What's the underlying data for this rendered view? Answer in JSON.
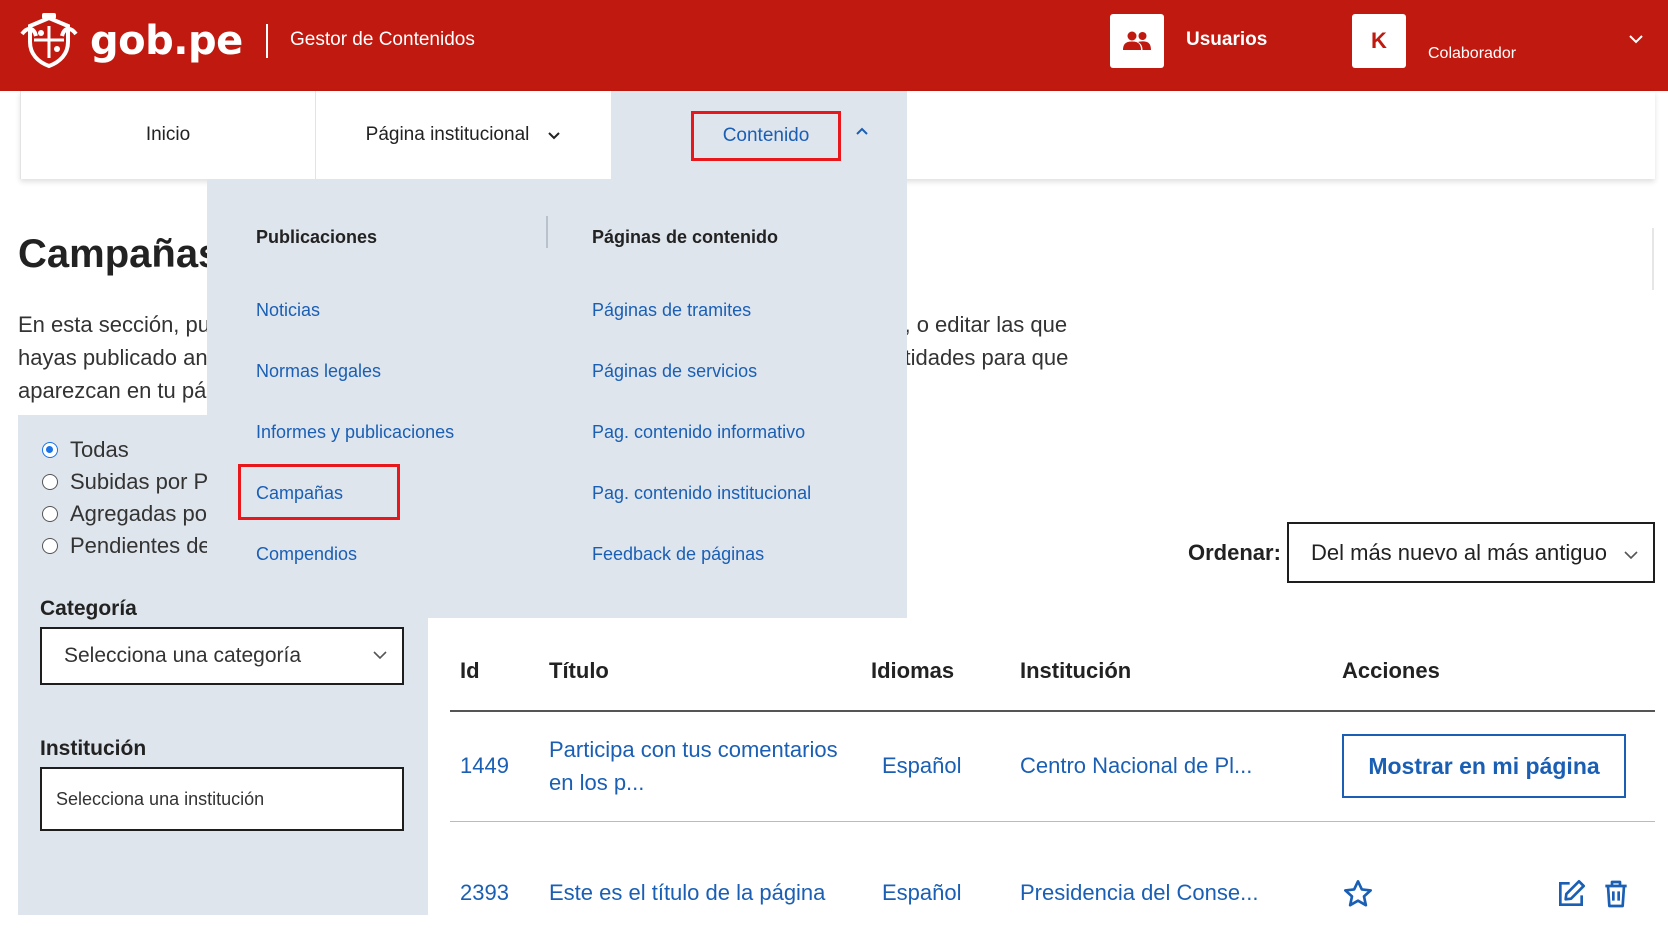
{
  "header": {
    "logo_text": "gob.pe",
    "app_name": "Gestor de Contenidos",
    "users_label": "Usuarios",
    "avatar_letter": "K",
    "role": "Colaborador",
    "brand_color": "#c0190f",
    "users_icon": "users-icon",
    "chevron_icon": "chevron-down-icon"
  },
  "nav": {
    "inicio": "Inicio",
    "pagina_institucional": "Página institucional",
    "contenido": "Contenido"
  },
  "mega_menu": {
    "col1_title": "Publicaciones",
    "col1_items": [
      "Noticias",
      "Normas legales",
      "Informes y publicaciones",
      "Campañas",
      "Compendios"
    ],
    "col2_title": "Páginas de contenido",
    "col2_items": [
      "Páginas de tramites",
      "Páginas de servicios",
      "Pag. contenido informativo",
      "Pag. contenido institucional",
      "Feedback de páginas"
    ]
  },
  "page": {
    "title": "Campañas",
    "intro_lines": [
      "En esta sección, pu",
      "hayas publicado an",
      "aparezcan en tu pá"
    ],
    "intro_right_lines": [
      "ad, o editar las que",
      "entidades para que"
    ]
  },
  "filters": {
    "radios": [
      "Todas",
      "Subidas por P",
      "Agregadas por",
      "Pendientes de"
    ],
    "selected_radio": "Todas",
    "categoria_label": "Categoría",
    "categoria_value": "Selecciona una categoría",
    "institucion_label": "Institución",
    "institucion_value": "Selecciona una institución"
  },
  "sort": {
    "label": "Ordenar:",
    "value": "Del más nuevo al más antiguo"
  },
  "table": {
    "columns": [
      "Id",
      "Título",
      "Idiomas",
      "Institución",
      "Acciones"
    ],
    "rows": [
      {
        "id": "1449",
        "title_line1": "Participa con tus comentarios",
        "title_line2": "en los p...",
        "language": "Español",
        "institution": "Centro Nacional de Pl...",
        "action_button": "Mostrar en mi página"
      },
      {
        "id": "2393",
        "title": "Este es el título de la página",
        "language": "Español",
        "institution": "Presidencia del Conse...",
        "action_icons": [
          "star-icon",
          "edit-icon",
          "trash-icon"
        ]
      }
    ]
  },
  "colors": {
    "link": "#1a5fb4",
    "panel": "#dfe5ed",
    "highlight": "#e8171b"
  }
}
